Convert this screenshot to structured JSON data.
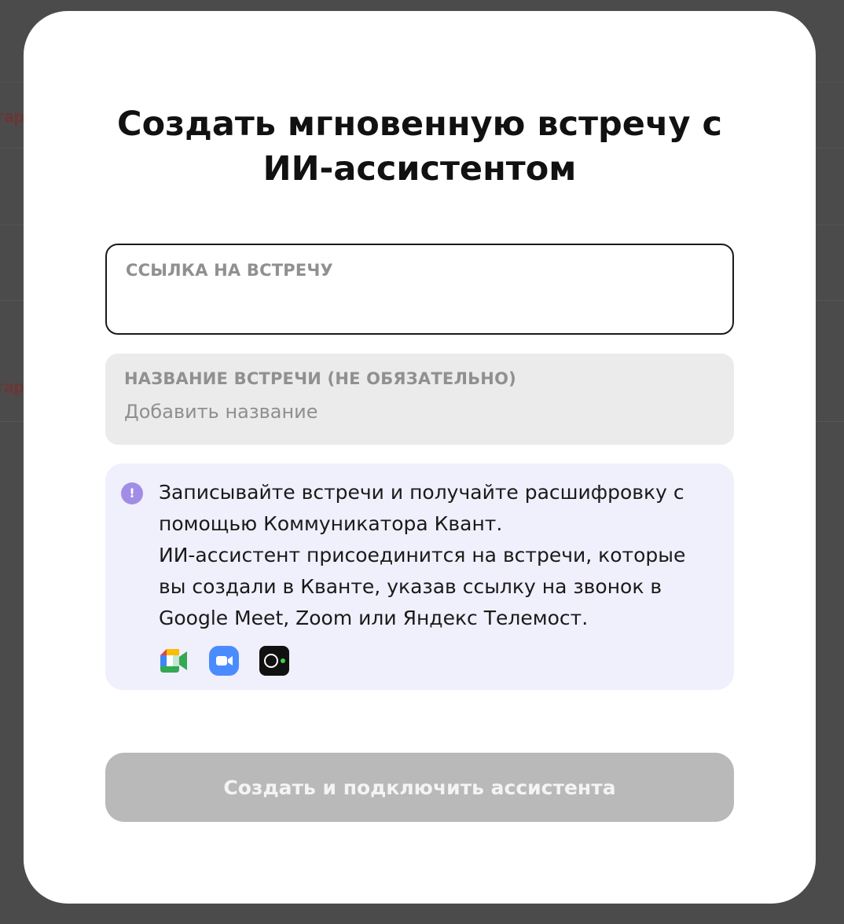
{
  "background": {
    "partial_labels": [
      "гар",
      "гар"
    ]
  },
  "modal": {
    "title_line1": "Создать мгновенную встречу с",
    "title_line2": "ИИ-ассистентом",
    "link_field": {
      "label": "ССЫЛКА НА ВСТРЕЧУ",
      "value": "",
      "placeholder": ""
    },
    "name_field": {
      "label": "НАЗВАНИЕ ВСТРЕЧИ (НЕ ОБЯЗАТЕЛЬНО)",
      "value": "",
      "placeholder": "Добавить название"
    },
    "info": {
      "icon": "exclamation-icon",
      "icon_glyph": "!",
      "paragraph1": "Записывайте встречи и получайте расшифровку с помощью Коммуникатора Квант.",
      "paragraph2": "ИИ-ассистент присоединится на встречи, которые вы создали в Кванте, указав ссылку на звонок в Google Meet, Zoom или Яндекс Телемост.",
      "services": [
        "google-meet-icon",
        "zoom-icon",
        "yandex-telemost-icon"
      ]
    },
    "submit_label": "Создать и подключить ассистента"
  },
  "colors": {
    "overlay": "#4b4b4b",
    "modal_bg": "#ffffff",
    "info_bg": "#f0effc",
    "info_icon": "#a18de6",
    "button_disabled": "#b9b9b9",
    "zoom_blue": "#4a8cff"
  }
}
